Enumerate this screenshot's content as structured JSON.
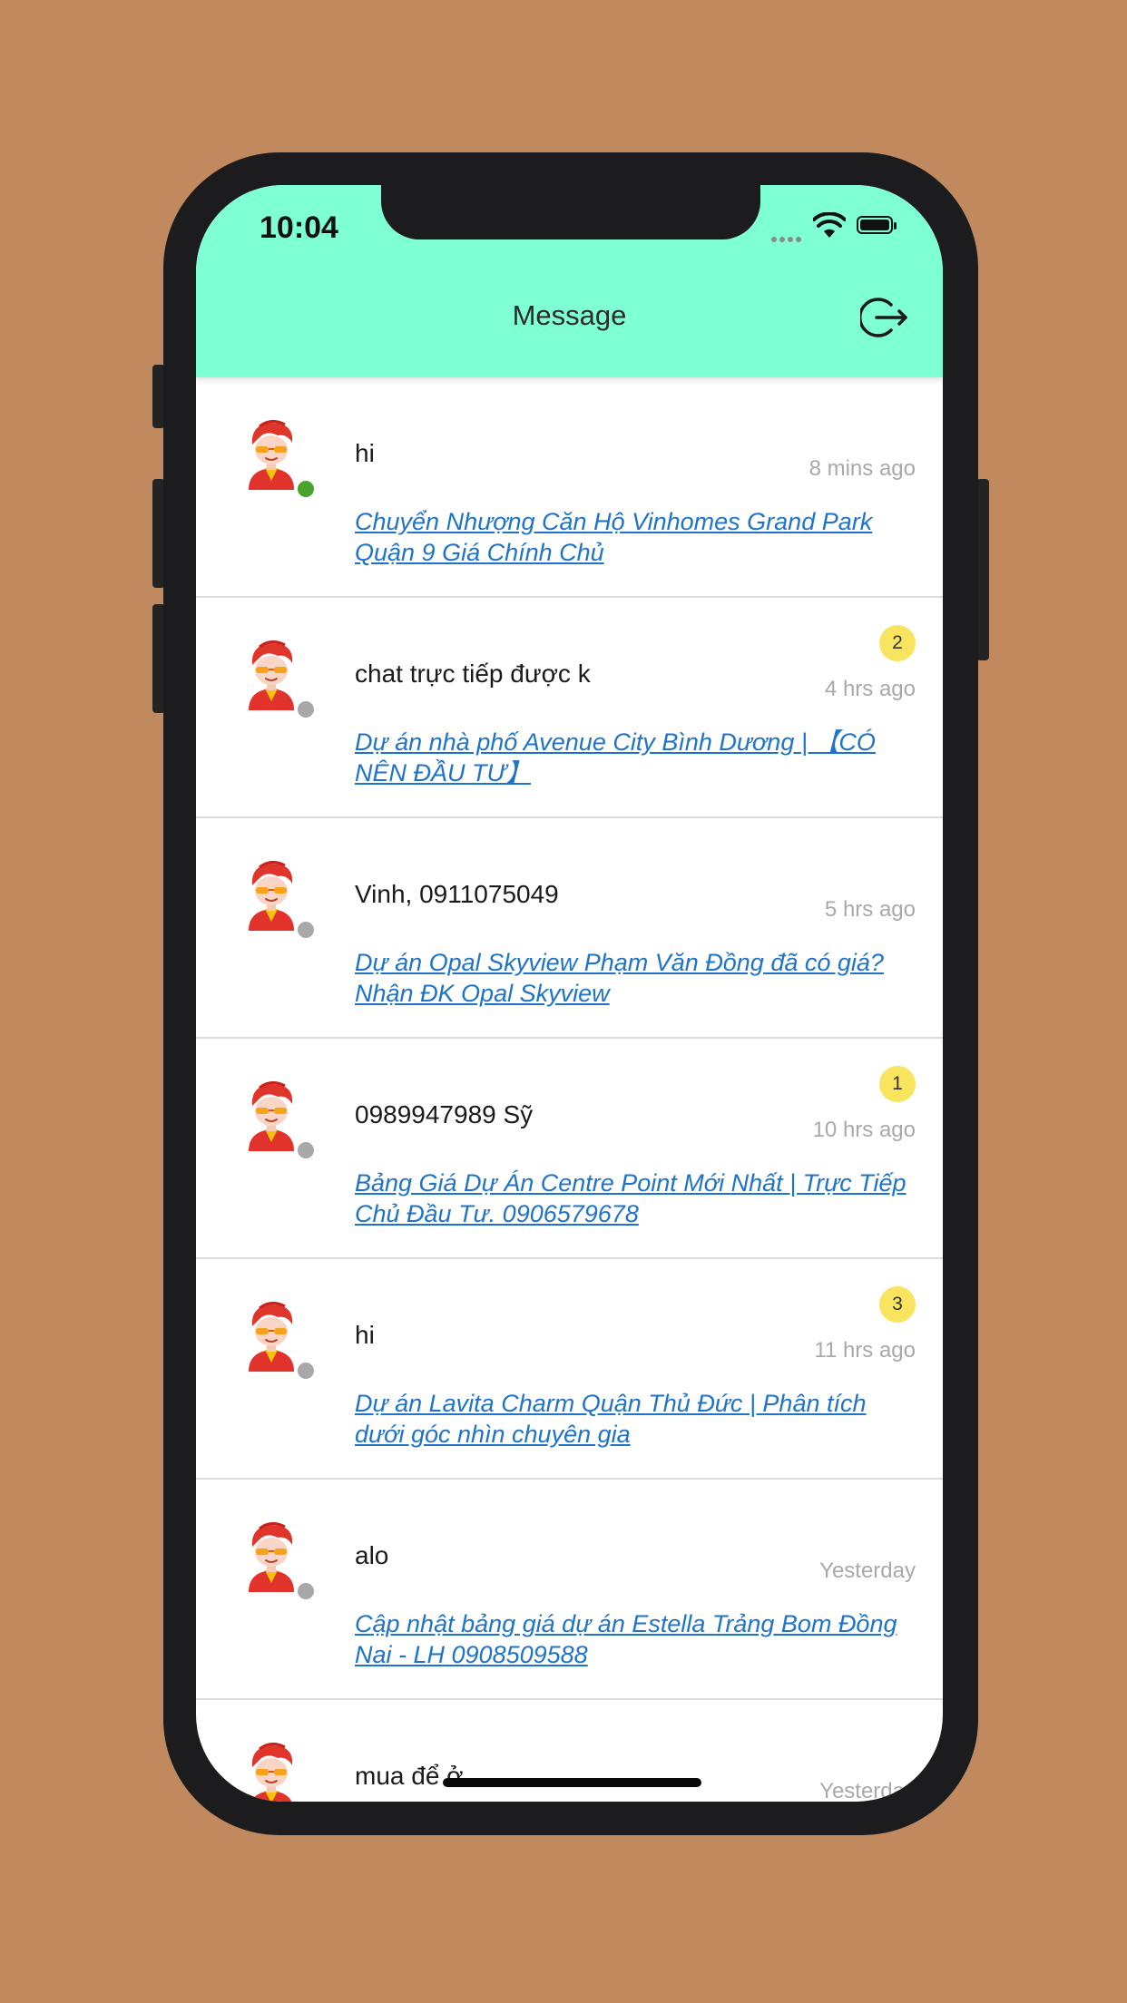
{
  "status_bar": {
    "time": "10:04"
  },
  "header": {
    "title": "Message",
    "logout_icon": "logout-icon"
  },
  "colors": {
    "header_bg": "#7fffd4",
    "link": "#1f73c8",
    "online": "#4aa32a",
    "offline": "#a8a8a8",
    "badge": "#f8e45e"
  },
  "conversations": [
    {
      "name": "hi",
      "time": "8 mins ago",
      "badge": "",
      "online": true,
      "subject": "Chuyển Nhượng Căn Hộ Vinhomes Grand Park Quận 9 Giá Chính Chủ"
    },
    {
      "name": "chat trực tiếp được k",
      "time": "4 hrs ago",
      "badge": "2",
      "online": false,
      "subject": "Dự án nhà phố Avenue City Bình Dương | 【CÓ NÊN ĐẦU TƯ】"
    },
    {
      "name": "Vinh, 0911075049",
      "time": "5 hrs ago",
      "badge": "",
      "online": false,
      "subject": "Dự án Opal Skyview Phạm Văn Đồng đã có giá? Nhận ĐK Opal Skyview"
    },
    {
      "name": "0989947989 Sỹ",
      "time": "10 hrs ago",
      "badge": "1",
      "online": false,
      "subject": "Bảng Giá Dự Án Centre Point Mới Nhất | Trực Tiếp Chủ Đầu Tư. 0906579678"
    },
    {
      "name": "hi",
      "time": "11 hrs ago",
      "badge": "3",
      "online": false,
      "subject": "Dự án Lavita Charm Quận Thủ Đức | Phân tích dưới góc nhìn chuyên gia"
    },
    {
      "name": "alo",
      "time": "Yesterday",
      "badge": "",
      "online": false,
      "subject": "Cập nhật bảng giá dự án Estella Trảng Bom Đồng Nai - LH 0908509588"
    },
    {
      "name": "mua để ở",
      "time": "Yesterday",
      "badge": "",
      "online": false,
      "subject": ""
    }
  ]
}
